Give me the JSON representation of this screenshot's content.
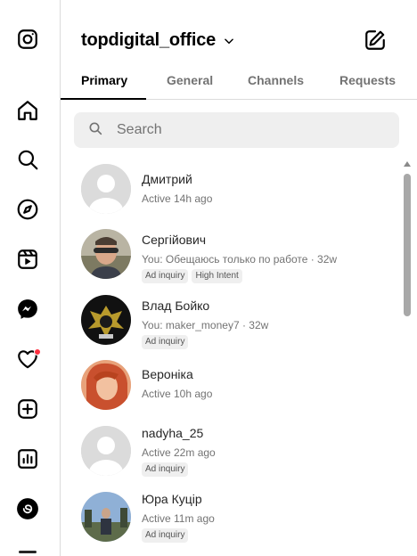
{
  "rail": {
    "icons": [
      "instagram-logo-icon",
      "home-icon",
      "search-icon",
      "explore-compass-icon",
      "reels-icon",
      "messenger-icon",
      "heart-icon",
      "create-plus-icon",
      "dashboard-bars-icon",
      "threads-icon"
    ]
  },
  "header": {
    "account_name": "topdigital_office"
  },
  "tabs": [
    {
      "label": "Primary",
      "active": true
    },
    {
      "label": "General",
      "active": false
    },
    {
      "label": "Channels",
      "active": false
    },
    {
      "label": "Requests",
      "active": false
    }
  ],
  "search": {
    "placeholder": "Search"
  },
  "conversations": [
    {
      "name": "Дмитрий",
      "preview": "Active 14h ago",
      "tags": []
    },
    {
      "name": "Сергійович",
      "preview": "You: Обещаюсь только по работе · 32w",
      "tags": [
        "Ad inquiry",
        "High Intent"
      ]
    },
    {
      "name": "Влад Бойко",
      "preview": "You: maker_money7 · 32w",
      "tags": [
        "Ad inquiry"
      ]
    },
    {
      "name": "Вероніка",
      "preview": "Active 10h ago",
      "tags": []
    },
    {
      "name": "nadyha_25",
      "preview": "Active 22m ago",
      "tags": [
        "Ad inquiry"
      ]
    },
    {
      "name": "Юра Куцір",
      "preview": "Active 11m ago",
      "tags": [
        "Ad inquiry"
      ]
    }
  ],
  "colors": {
    "notification_dot": "#ff3040",
    "search_bg": "#efefef",
    "divider": "#dbdbdb",
    "secondary_text": "#737373"
  }
}
